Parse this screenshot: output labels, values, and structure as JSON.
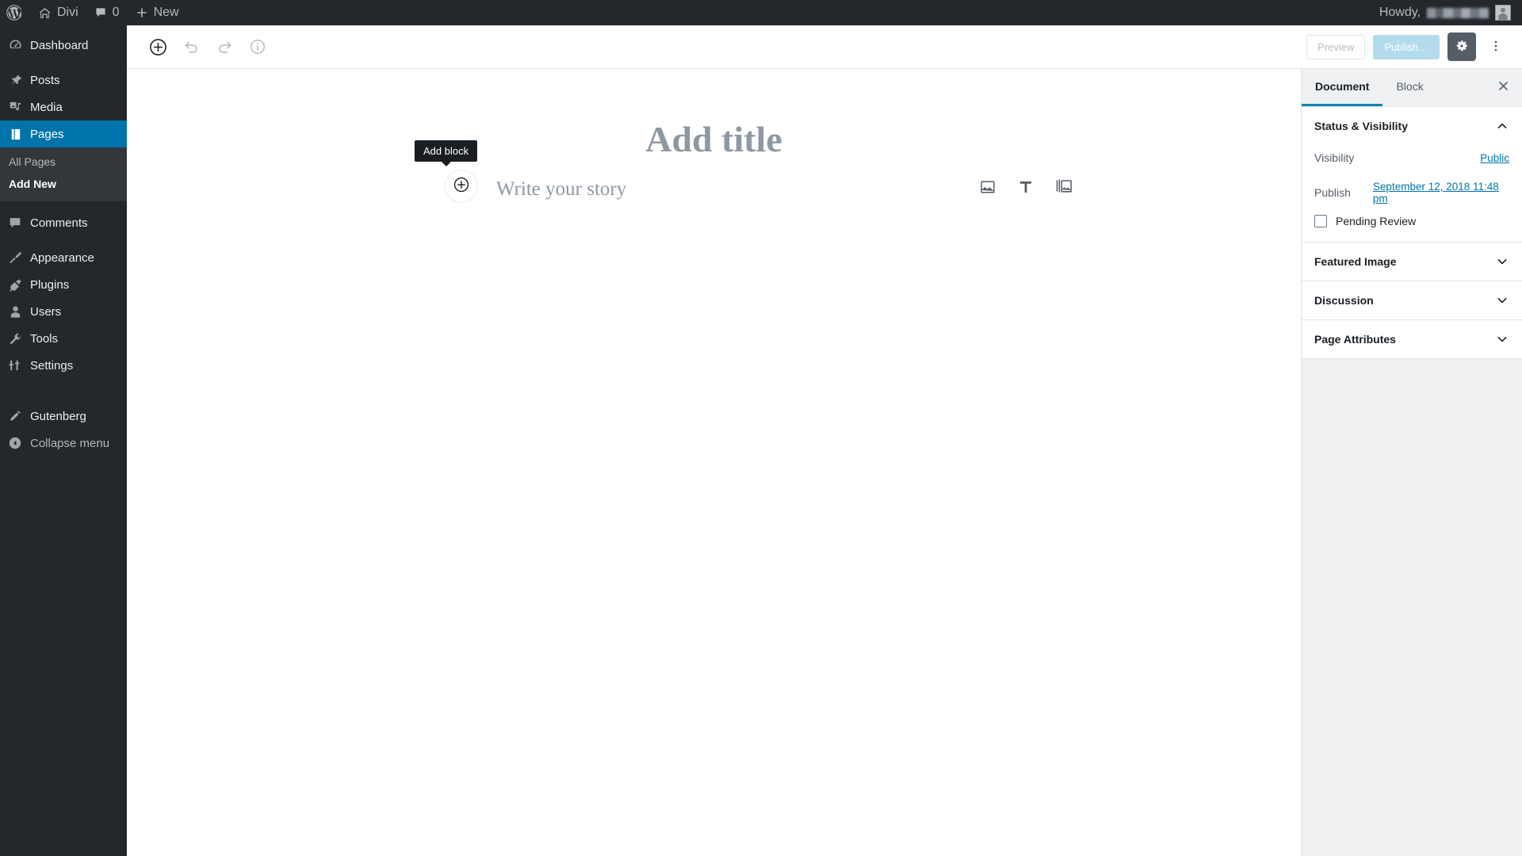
{
  "adminbar": {
    "logo_icon": "wordpress-logo-icon",
    "site_name": "Divi",
    "home_icon": "home-icon",
    "comments_icon": "comment-bubble-icon",
    "comments_count": "0",
    "new_icon": "plus-icon",
    "new_label": "New",
    "howdy_label": "Howdy,",
    "howdy_user_redacted": "",
    "avatar_icon": "user-avatar-icon"
  },
  "adminmenu": {
    "items": [
      {
        "label": "Dashboard",
        "icon": "dashboard-icon",
        "current": false
      },
      {
        "label": "Posts",
        "icon": "pin-icon",
        "current": false
      },
      {
        "label": "Media",
        "icon": "media-icon",
        "current": false
      },
      {
        "label": "Pages",
        "icon": "pages-icon",
        "current": true
      },
      {
        "label": "Comments",
        "icon": "comment-bubble-icon",
        "current": false
      },
      {
        "label": "Appearance",
        "icon": "paintbrush-icon",
        "current": false
      },
      {
        "label": "Plugins",
        "icon": "plug-icon",
        "current": false
      },
      {
        "label": "Users",
        "icon": "user-icon",
        "current": false
      },
      {
        "label": "Tools",
        "icon": "wrench-icon",
        "current": false
      },
      {
        "label": "Settings",
        "icon": "sliders-icon",
        "current": false
      },
      {
        "label": "Gutenberg",
        "icon": "pencil-icon",
        "current": false
      }
    ],
    "submenu": [
      {
        "label": "All Pages",
        "current": false
      },
      {
        "label": "Add New",
        "current": true
      }
    ],
    "collapse": {
      "label": "Collapse menu",
      "icon": "collapse-arrow-icon"
    }
  },
  "editor_header": {
    "inserter_icon": "plus-circle-icon",
    "undo_icon": "undo-icon",
    "redo_icon": "redo-icon",
    "info_icon": "info-circle-icon",
    "preview_label": "Preview",
    "publish_label": "Publish…",
    "settings_icon": "gear-icon",
    "more_icon": "ellipsis-vertical-icon"
  },
  "canvas": {
    "title_placeholder": "Add title",
    "appender_icon": "plus-circle-icon",
    "appender_tooltip": "Add block",
    "story_placeholder": "Write your story",
    "quick_blocks": [
      {
        "icon": "image-block-icon"
      },
      {
        "icon": "text-block-icon"
      },
      {
        "icon": "gallery-block-icon"
      }
    ]
  },
  "settings_sidebar": {
    "tabs": [
      {
        "label": "Document",
        "active": true
      },
      {
        "label": "Block",
        "active": false
      }
    ],
    "close_icon": "close-icon",
    "panels": [
      {
        "title": "Status & Visibility",
        "expanded": true,
        "chevron": "chevron-up-icon",
        "visibility_label": "Visibility",
        "visibility_value": "Public",
        "publish_label": "Publish",
        "publish_value": "September 12, 2018 11:48 pm",
        "pending_review_label": "Pending Review",
        "pending_review_checked": false
      },
      {
        "title": "Featured Image",
        "expanded": false,
        "chevron": "chevron-down-icon"
      },
      {
        "title": "Discussion",
        "expanded": false,
        "chevron": "chevron-down-icon"
      },
      {
        "title": "Page Attributes",
        "expanded": false,
        "chevron": "chevron-down-icon"
      }
    ]
  },
  "colors": {
    "admin_dark": "#23282d",
    "admin_submenu": "#32373c",
    "accent_blue": "#0073aa",
    "tab_underline": "#0085ba",
    "publish_disabled": "#b3dbec",
    "settings_button": "#555d66",
    "sidebar_bg": "#eef0f1"
  }
}
